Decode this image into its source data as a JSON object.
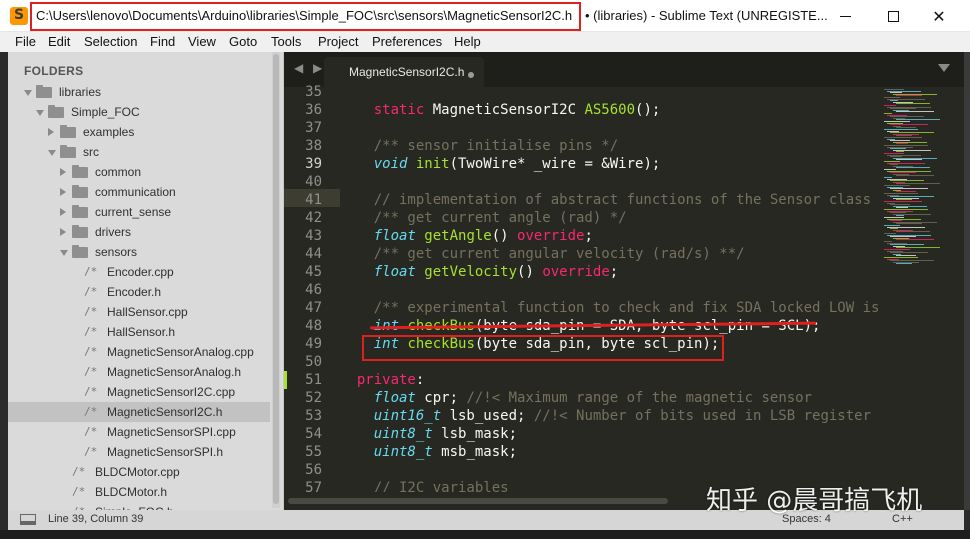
{
  "window": {
    "title_path": "C:\\Users\\lenovo\\Documents\\Arduino\\libraries\\Simple_FOC\\src\\sensors\\MagneticSensorI2C.h",
    "title_rest": "• (libraries) - Sublime Text (UNREGISTE...",
    "minimize_glyph": "",
    "close_glyph": "✕"
  },
  "menu": [
    "File",
    "Edit",
    "Selection",
    "Find",
    "View",
    "Goto",
    "Tools",
    "Project",
    "Preferences",
    "Help"
  ],
  "sidebar": {
    "header": "FOLDERS",
    "items": [
      {
        "label": "libraries",
        "kind": "folder",
        "state": "open"
      },
      {
        "label": "Simple_FOC",
        "kind": "folder",
        "state": "open"
      },
      {
        "label": "examples",
        "kind": "folder",
        "state": "closed"
      },
      {
        "label": "src",
        "kind": "folder",
        "state": "open"
      },
      {
        "label": "common",
        "kind": "folder",
        "state": "closed"
      },
      {
        "label": "communication",
        "kind": "folder",
        "state": "closed"
      },
      {
        "label": "current_sense",
        "kind": "folder",
        "state": "closed"
      },
      {
        "label": "drivers",
        "kind": "folder",
        "state": "closed"
      },
      {
        "label": "sensors",
        "kind": "folder",
        "state": "open"
      },
      {
        "label": "Encoder.cpp",
        "kind": "file"
      },
      {
        "label": "Encoder.h",
        "kind": "file"
      },
      {
        "label": "HallSensor.cpp",
        "kind": "file"
      },
      {
        "label": "HallSensor.h",
        "kind": "file"
      },
      {
        "label": "MagneticSensorAnalog.cpp",
        "kind": "file"
      },
      {
        "label": "MagneticSensorAnalog.h",
        "kind": "file"
      },
      {
        "label": "MagneticSensorI2C.cpp",
        "kind": "file"
      },
      {
        "label": "MagneticSensorI2C.h",
        "kind": "file",
        "selected": true
      },
      {
        "label": "MagneticSensorSPI.cpp",
        "kind": "file"
      },
      {
        "label": "MagneticSensorSPI.h",
        "kind": "file"
      },
      {
        "label": "BLDCMotor.cpp",
        "kind": "file"
      },
      {
        "label": "BLDCMotor.h",
        "kind": "file"
      },
      {
        "label": "Simple_FOC.h",
        "kind": "file"
      }
    ],
    "file_glyph": "/*"
  },
  "editor": {
    "nav_glyph": "◀ ▶",
    "tab_label": "MagneticSensorI2C.h",
    "line_numbers": [
      "35",
      "36",
      "37",
      "38",
      "39",
      "40",
      "41",
      "42",
      "43",
      "44",
      "45",
      "46",
      "47",
      "48",
      "49",
      "50",
      "51",
      "52",
      "53",
      "54",
      "55",
      "56",
      "57"
    ],
    "current_line": "39",
    "code": [
      [],
      [
        [
          "kw",
          "    static "
        ],
        [
          "",
          "MagneticSensorI2C "
        ],
        [
          "fn",
          "AS5600"
        ],
        [
          "",
          "();"
        ]
      ],
      [],
      [
        [
          "cm",
          "    /** sensor initialise pins */"
        ]
      ],
      [
        [
          "ty",
          "    void "
        ],
        [
          "fn",
          "init"
        ],
        [
          "",
          "(TwoWire* _wire = &Wire);"
        ]
      ],
      [],
      [
        [
          "cm",
          "    // implementation of abstract functions of the Sensor class"
        ]
      ],
      [
        [
          "cm",
          "    /** get current angle (rad) */"
        ]
      ],
      [
        [
          "ty",
          "    float "
        ],
        [
          "fn",
          "getAngle"
        ],
        [
          "",
          "() "
        ],
        [
          "kw",
          "override"
        ],
        [
          "",
          ";"
        ]
      ],
      [
        [
          "cm",
          "    /** get current angular velocity (rad/s) **/"
        ]
      ],
      [
        [
          "ty",
          "    float "
        ],
        [
          "fn",
          "getVelocity"
        ],
        [
          "",
          "() "
        ],
        [
          "kw",
          "override"
        ],
        [
          "",
          ";"
        ]
      ],
      [],
      [
        [
          "cm",
          "    /** experimental function to check and fix SDA locked LOW issue"
        ]
      ],
      [
        [
          "ty",
          "    int "
        ],
        [
          "fn",
          "checkBus"
        ],
        [
          "",
          "(byte sda_pin = SDA, byte scl_pin = SCL);"
        ]
      ],
      [
        [
          "ty",
          "    int "
        ],
        [
          "fn",
          "checkBus"
        ],
        [
          "",
          "(byte sda_pin, byte scl_pin);"
        ]
      ],
      [],
      [
        [
          "kw",
          "  private"
        ],
        [
          "",
          ":"
        ]
      ],
      [
        [
          "ty",
          "    float "
        ],
        [
          "",
          "cpr; "
        ],
        [
          "cm",
          "//!< Maximum range of the magnetic sensor"
        ]
      ],
      [
        [
          "ty",
          "    uint16_t "
        ],
        [
          "",
          "lsb_used; "
        ],
        [
          "cm",
          "//!< Number of bits used in LSB register"
        ]
      ],
      [
        [
          "ty",
          "    uint8_t "
        ],
        [
          "",
          "lsb_mask;"
        ]
      ],
      [
        [
          "ty",
          "    uint8_t "
        ],
        [
          "",
          "msb_mask;"
        ]
      ],
      [],
      [
        [
          "cm",
          "    // I2C variables"
        ]
      ]
    ]
  },
  "status": {
    "position": "Line 39, Column 39",
    "spaces": "Spaces: 4",
    "syntax": "C++"
  },
  "watermark": "知乎 @晨哥搞飞机",
  "colors": {
    "editor_bg": "#272822",
    "keyword": "#f92672",
    "type": "#66d9ef",
    "function": "#a6e22e",
    "comment": "#75715e",
    "annotation_red": "#e02020"
  }
}
